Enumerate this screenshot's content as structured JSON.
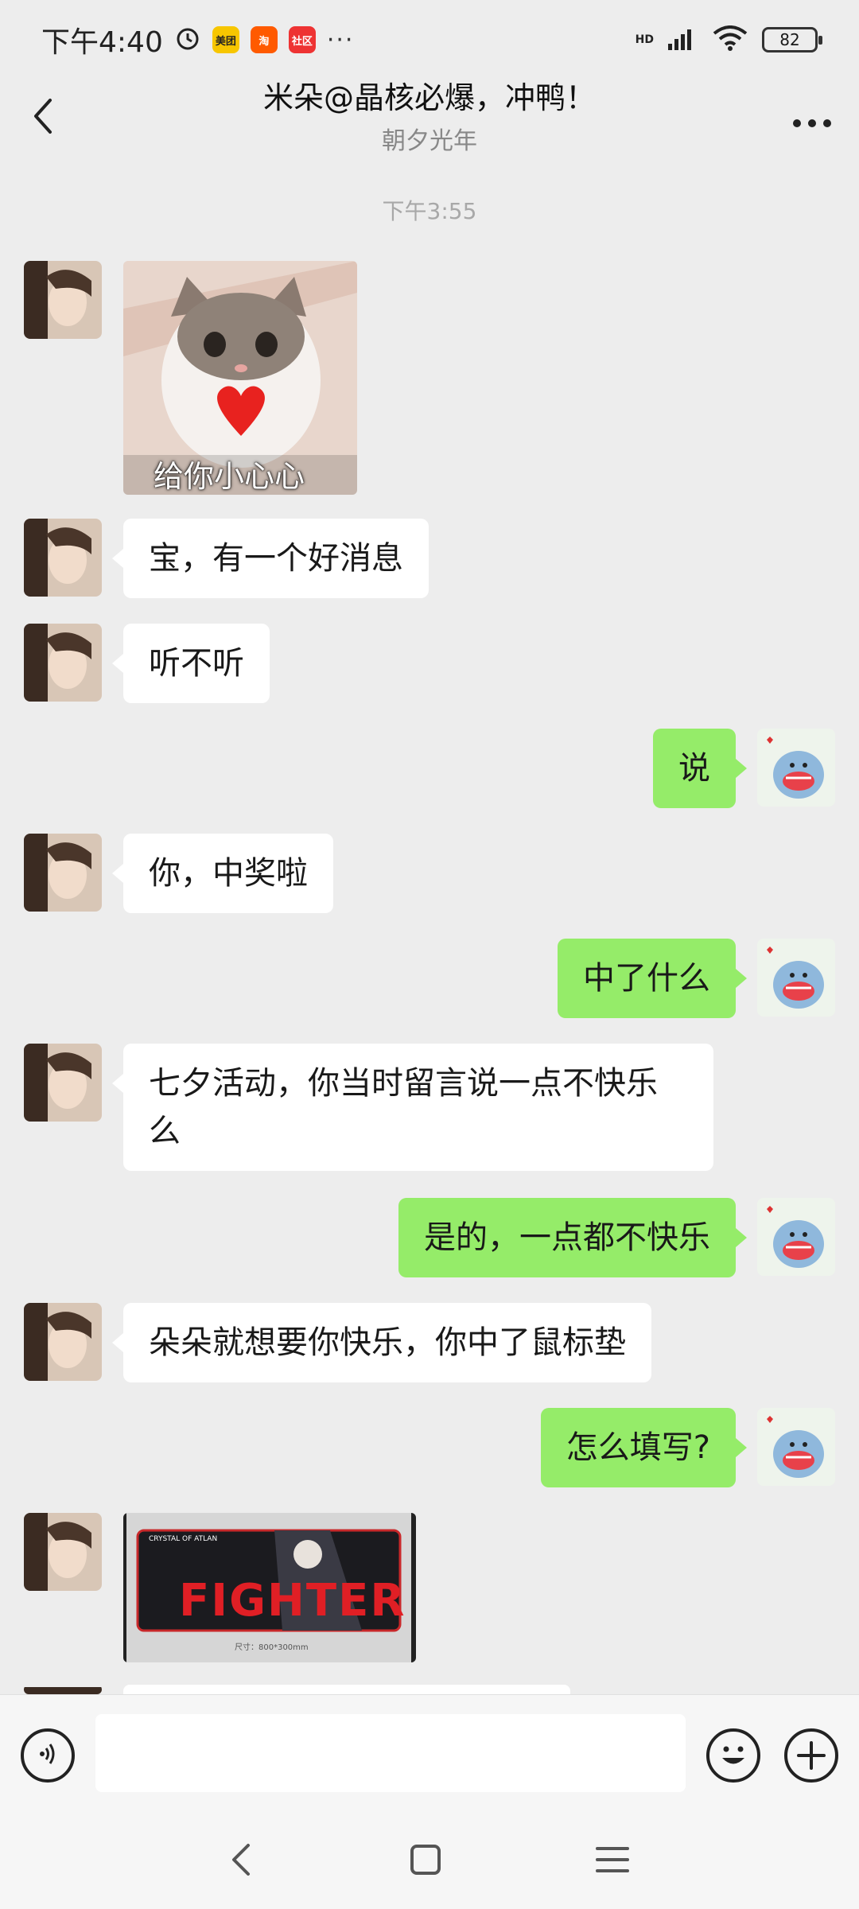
{
  "status_bar": {
    "time": "下午4:40",
    "apps": [
      "美团",
      "淘",
      "社区"
    ],
    "more": "···",
    "signal": "HD",
    "battery": "82"
  },
  "header": {
    "title": "米朵@晶核必爆，冲鸭！",
    "subtitle": "朝夕光年",
    "back_icon": "chevron-left-icon",
    "more_icon": "more-horizontal-icon"
  },
  "chat": {
    "time_divider": "下午3:55",
    "messages": [
      {
        "side": "left",
        "type": "image",
        "caption": "给你小心心"
      },
      {
        "side": "left",
        "type": "text",
        "text": "宝，有一个好消息"
      },
      {
        "side": "left",
        "type": "text",
        "text": "听不听"
      },
      {
        "side": "right",
        "type": "text",
        "text": "说"
      },
      {
        "side": "left",
        "type": "text",
        "text": "你，中奖啦"
      },
      {
        "side": "right",
        "type": "text",
        "text": "中了什么"
      },
      {
        "side": "left",
        "type": "text",
        "text": "七夕活动，你当时留言说一点不快乐么"
      },
      {
        "side": "right",
        "type": "text",
        "text": "是的，一点都不快乐"
      },
      {
        "side": "left",
        "type": "text",
        "text": "朵朵就想要你快乐，你中了鼠标垫"
      },
      {
        "side": "right",
        "type": "text",
        "text": "怎么填写?"
      },
      {
        "side": "left",
        "type": "image",
        "caption": "FIGHTER",
        "subcaption": "尺寸：800*300mm",
        "brand": "CRYSTAL OF ATLAN"
      }
    ]
  },
  "input_bar": {
    "voice_icon": "voice-icon",
    "emoji_icon": "emoji-icon",
    "plus_icon": "plus-icon",
    "placeholder": ""
  },
  "nav_bar": {
    "back_icon": "nav-back-icon",
    "home_icon": "nav-home-icon",
    "menu_icon": "nav-menu-icon"
  },
  "colors": {
    "background": "#ededed",
    "bubble_self": "#95ec69",
    "bubble_other": "#ffffff"
  }
}
